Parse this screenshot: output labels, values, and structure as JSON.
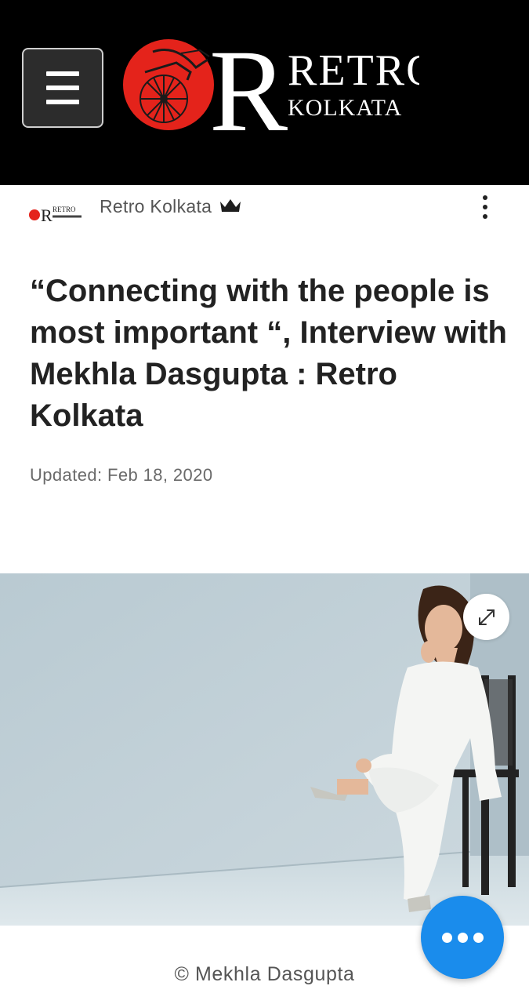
{
  "header": {
    "logo_text_retro": "RETRO",
    "logo_text_kolkata": "KOLKATA",
    "logo_letter": "R"
  },
  "author": {
    "name": "Retro Kolkata",
    "avatar_text": "RETRO"
  },
  "article": {
    "title": "“Connecting with the people is most important “, Interview with Mekhla Dasgupta : Retro Kolkata",
    "updated": "Updated: Feb 18, 2020",
    "image_caption": "© Mekhla Dasgupta"
  },
  "colors": {
    "header_bg": "#000000",
    "logo_red": "#e4231b",
    "fab_blue": "#1a8cec",
    "hero_bg": "#c3d2d9"
  },
  "icons": {
    "menu": "hamburger-icon",
    "crown": "crown-icon",
    "more": "more-vertical-icon",
    "expand": "expand-icon",
    "fab": "more-horizontal-icon"
  }
}
